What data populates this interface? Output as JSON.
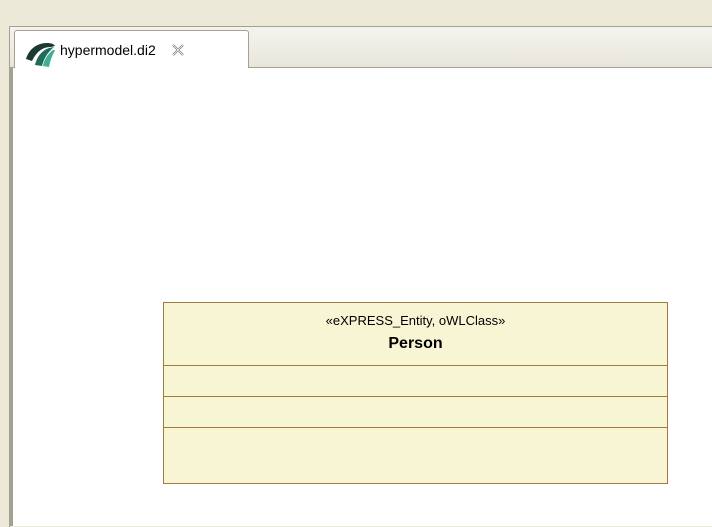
{
  "editor": {
    "tab": {
      "label": "hypermodel.di2",
      "icon": "papyrus-diagram-icon",
      "close_icon": "close-icon"
    }
  },
  "diagram": {
    "class": {
      "stereotype": "«eXPRESS_Entity, oWLClass»",
      "name": "Person",
      "compartments": [
        "",
        "",
        ""
      ]
    },
    "colors": {
      "class_fill": "#f7f5d3",
      "class_border": "#a37a3e",
      "canvas": "#ffffff"
    }
  }
}
